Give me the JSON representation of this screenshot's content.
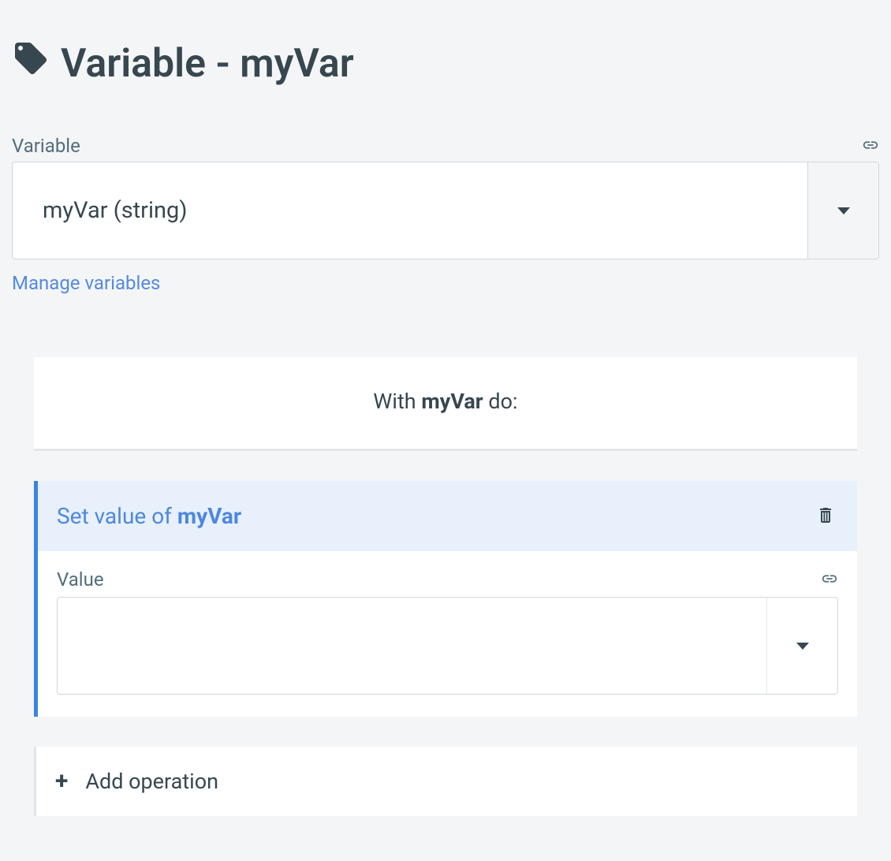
{
  "header": {
    "title_prefix": "Variable - ",
    "variable_name": "myVar"
  },
  "variable_field": {
    "label": "Variable",
    "selected": "myVar (string)"
  },
  "manage_link": "Manage variables",
  "with_block": {
    "prefix": "With ",
    "var": "myVar",
    "suffix": " do:"
  },
  "operation": {
    "title_prefix": "Set value of ",
    "title_var": "myVar",
    "value_label": "Value",
    "value_selected": ""
  },
  "add_operation": {
    "label": "Add operation"
  }
}
